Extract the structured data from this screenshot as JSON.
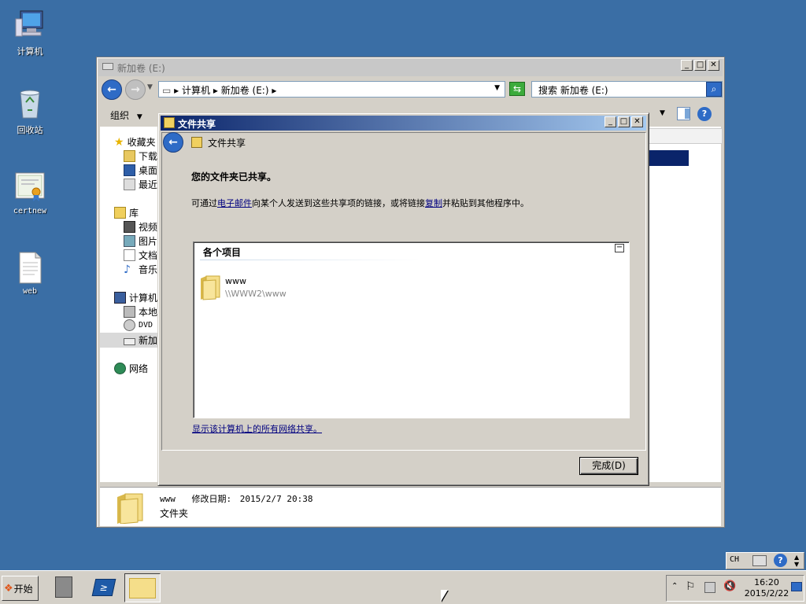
{
  "desktop": {
    "icons": [
      {
        "label": "计算机",
        "icon": "computer-icon"
      },
      {
        "label": "回收站",
        "icon": "recycle-bin-icon"
      },
      {
        "label": "certnew",
        "icon": "certificate-icon"
      },
      {
        "label": "web",
        "icon": "document-icon"
      }
    ]
  },
  "explorer": {
    "title": "新加卷 (E:)",
    "address": {
      "seg1": "计算机",
      "seg2": "新加卷 (E:)"
    },
    "search_placeholder": "搜索 新加卷 (E:)",
    "toolbar": {
      "organize": "组织"
    },
    "nav": {
      "favorites": "收藏夹",
      "downloads": "下载",
      "desktop": "桌面",
      "recent": "最近",
      "libraries": "库",
      "videos": "视频",
      "pictures": "图片",
      "documents": "文档",
      "music": "音乐",
      "computer": "计算机",
      "local": "本地",
      "dvd": "DVD",
      "newvol": "新加",
      "network": "网络"
    },
    "details": {
      "name": "www",
      "modified_label": "修改日期:",
      "modified_value": "2015/2/7 20:38",
      "type": "文件夹"
    }
  },
  "dialog": {
    "title": "文件共享",
    "header": "文件共享",
    "heading": "您的文件夹已共享。",
    "desc_prefix": "可通过",
    "desc_link_email": "电子邮件",
    "desc_middle": "向某个人发送到这些共享项的链接，或将链接",
    "desc_link_copy": "复制",
    "desc_suffix": "并粘贴到其他程序中。",
    "items_header": "各个项目",
    "item": {
      "name": "www",
      "path": "\\\\WWW2\\www"
    },
    "show_all_link": "显示该计算机上的所有网络共享。",
    "done_button": "完成(D)"
  },
  "taskbar": {
    "start": "开始",
    "lang": "CH",
    "clock": {
      "time": "16:20",
      "date": "2015/2/22"
    }
  }
}
